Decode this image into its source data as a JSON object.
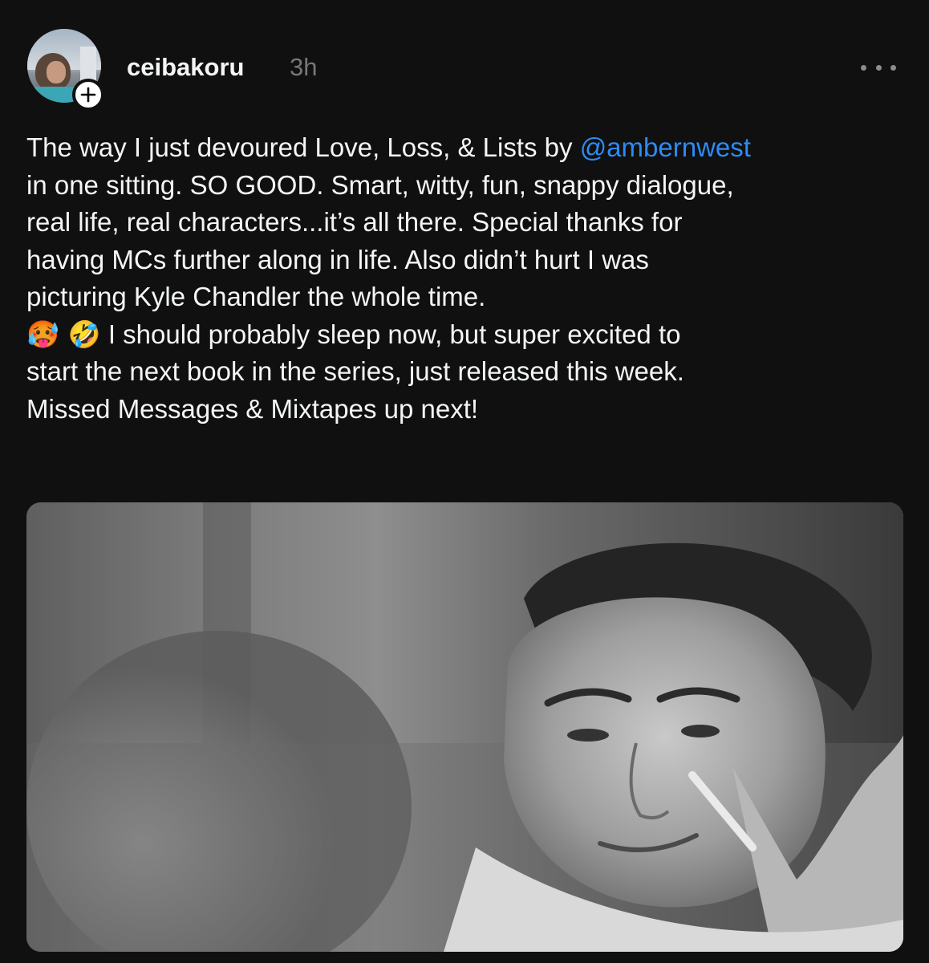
{
  "post": {
    "username": "ceibakoru",
    "timestamp": "3h",
    "follow_icon": "plus-icon",
    "more_icon": "ellipsis-icon",
    "body_lines": {
      "l1_pre": "The way I just devoured Love, Loss, & Lists by ",
      "l1_mention": "@ambernwest",
      "l2": "in one sitting. SO GOOD. Smart, witty, fun, snappy dialogue,",
      "l3": "real life, real characters...it’s all there. Special thanks for",
      "l4": "having MCs further along in life. Also didn’t hurt I was",
      "l5": "picturing Kyle Chandler the whole time.",
      "l6_emoji": "🥵 🤣",
      "l6_text": " I should probably sleep now, but super excited to",
      "l7": "start the next book in the series, just released this week.",
      "l8": "Missed Messages & Mixtapes up next!"
    },
    "colors": {
      "background": "#101010",
      "text": "#f3f5f7",
      "muted": "#777777",
      "mention": "#2e8bf5"
    }
  }
}
